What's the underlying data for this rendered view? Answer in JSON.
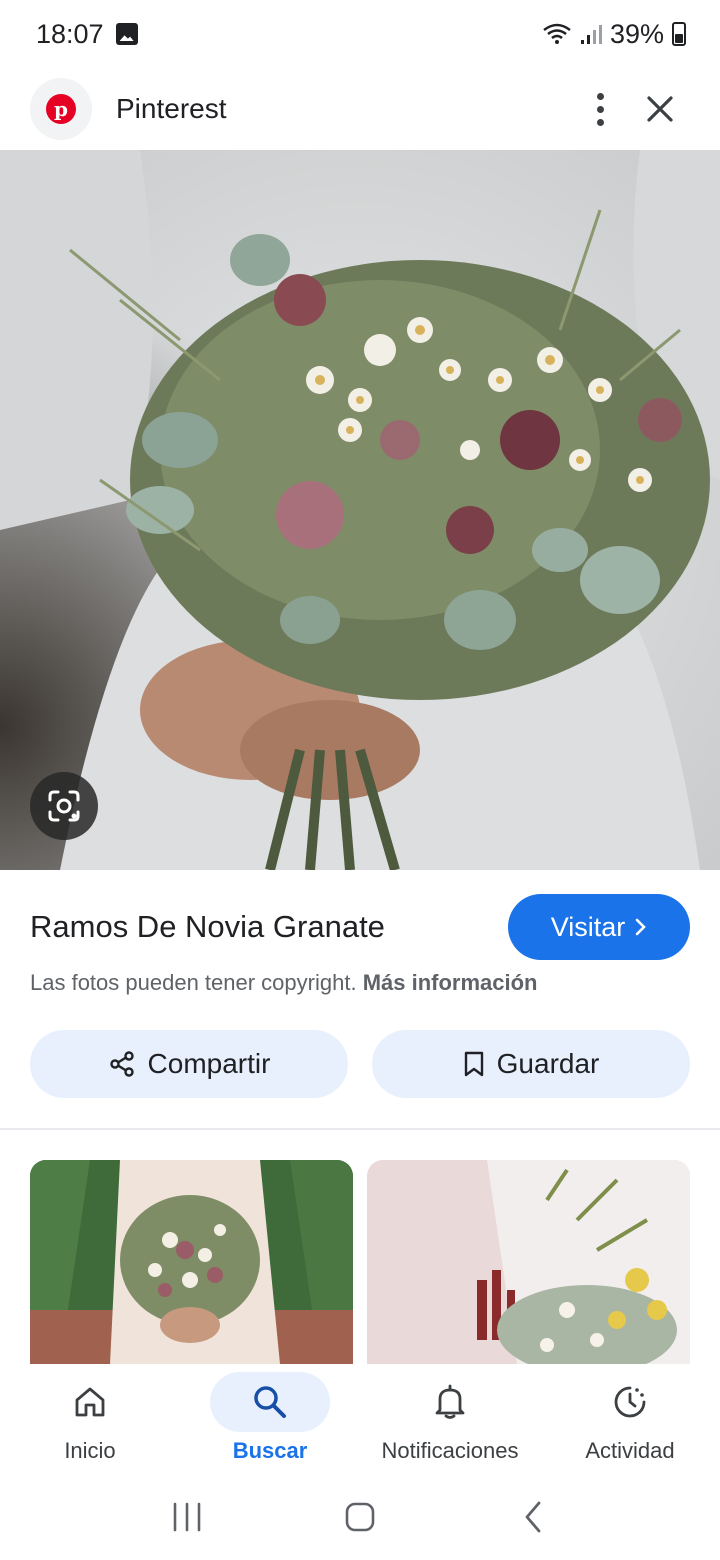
{
  "status_bar": {
    "time": "18:07",
    "battery": "39%"
  },
  "header": {
    "app_name": "Pinterest",
    "logo_letter": "p"
  },
  "pin": {
    "title": "Ramos De Novia Granate",
    "visit_label": "Visitar",
    "copyright_text": "Las fotos pueden tener copyright.",
    "more_info_label": "Más información",
    "share_label": "Compartir",
    "save_label": "Guardar"
  },
  "bottom_nav": {
    "items": [
      {
        "label": "Inicio",
        "icon": "home-icon",
        "active": false
      },
      {
        "label": "Buscar",
        "icon": "search-icon",
        "active": true
      },
      {
        "label": "Notificaciones",
        "icon": "bell-icon",
        "active": false
      },
      {
        "label": "Actividad",
        "icon": "activity-icon",
        "active": false
      }
    ]
  },
  "colors": {
    "accent": "#1a73e8",
    "pinterest_red": "#e60023",
    "pill_bg": "#e8f0fe"
  }
}
